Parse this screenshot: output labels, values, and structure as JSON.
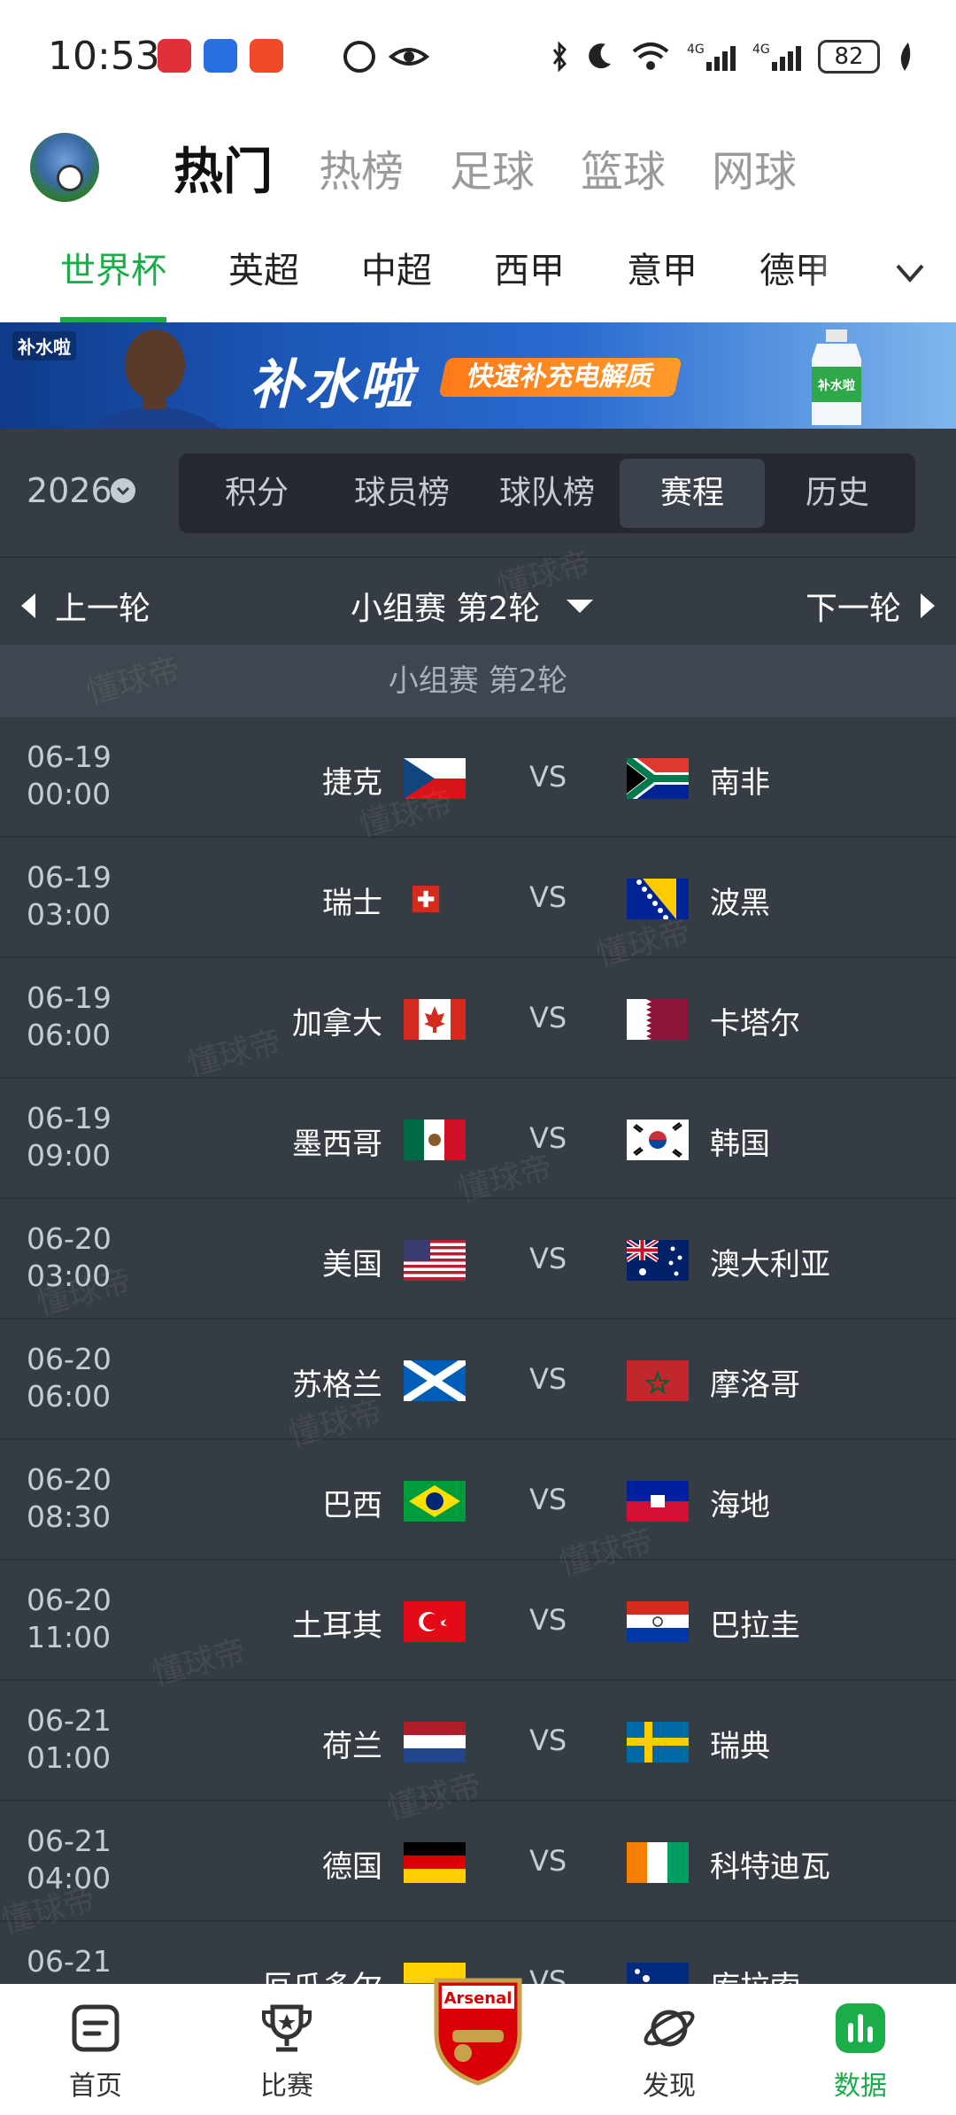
{
  "status_bar": {
    "time": "10:53",
    "battery": "82"
  },
  "top_tabs": [
    "热门",
    "热榜",
    "足球",
    "篮球",
    "网球"
  ],
  "sub_tabs": [
    "世界杯",
    "英超",
    "中超",
    "西甲",
    "意甲",
    "德甲"
  ],
  "banner": {
    "logo": "补水啦",
    "title": "补水啦",
    "slogan": "快速补充电解质",
    "bottle_label": "补水啦"
  },
  "season": {
    "year": "2026"
  },
  "segments": [
    "积分",
    "球员榜",
    "球队榜",
    "赛程",
    "历史"
  ],
  "round_nav": {
    "prev": "上一轮",
    "current": "小组赛 第2轮",
    "next": "下一轮"
  },
  "group_title": "小组赛 第2轮",
  "vs_label": "VS",
  "watermark": "懂球帝",
  "matches": [
    {
      "date": "06-19",
      "time": "00:00",
      "home": "捷克",
      "away": "南非"
    },
    {
      "date": "06-19",
      "time": "03:00",
      "home": "瑞士",
      "away": "波黑"
    },
    {
      "date": "06-19",
      "time": "06:00",
      "home": "加拿大",
      "away": "卡塔尔"
    },
    {
      "date": "06-19",
      "time": "09:00",
      "home": "墨西哥",
      "away": "韩国"
    },
    {
      "date": "06-20",
      "time": "03:00",
      "home": "美国",
      "away": "澳大利亚"
    },
    {
      "date": "06-20",
      "time": "06:00",
      "home": "苏格兰",
      "away": "摩洛哥"
    },
    {
      "date": "06-20",
      "time": "08:30",
      "home": "巴西",
      "away": "海地"
    },
    {
      "date": "06-20",
      "time": "11:00",
      "home": "土耳其",
      "away": "巴拉圭"
    },
    {
      "date": "06-21",
      "time": "01:00",
      "home": "荷兰",
      "away": "瑞典"
    },
    {
      "date": "06-21",
      "time": "04:00",
      "home": "德国",
      "away": "科特迪瓦"
    },
    {
      "date": "06-21",
      "time": "",
      "home": "厄瓜多尔",
      "away": "库拉索"
    }
  ],
  "bottom_nav": [
    {
      "label": "首页",
      "icon": "home-icon"
    },
    {
      "label": "比赛",
      "icon": "trophy-icon"
    },
    {
      "label": "",
      "icon": "arsenal-badge-icon",
      "badge_text": "Arsenal"
    },
    {
      "label": "发现",
      "icon": "planet-icon"
    },
    {
      "label": "数据",
      "icon": "chart-icon"
    }
  ],
  "colors": {
    "accent": "#1aad4a",
    "bg_dark": "#363c44",
    "segment_bg": "#262a30"
  }
}
